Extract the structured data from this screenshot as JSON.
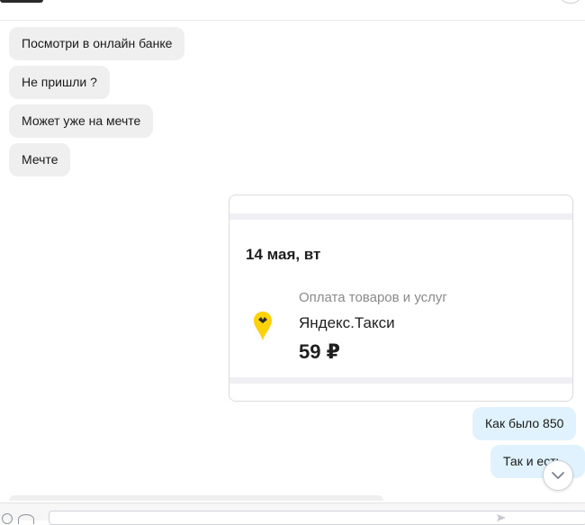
{
  "messages_in": [
    {
      "text": "Посмотри в онлайн банке"
    },
    {
      "text": "Не пришли ?"
    },
    {
      "text": "Может уже на мечте"
    },
    {
      "text": "Мечте"
    }
  ],
  "attachment": {
    "date": "14 мая, вт",
    "category": "Оплата товаров и услуг",
    "merchant": "Яндекс.Такси",
    "amount": "59 ₽",
    "icon": "yandex-taxi-pin-icon",
    "icon_color": "#fcd20a"
  },
  "messages_out": [
    {
      "text": "Как было 850"
    },
    {
      "text": "Так и есть"
    }
  ],
  "colors": {
    "incoming_bubble": "#efefef",
    "outgoing_bubble": "#dff2fd"
  },
  "icons": {
    "scroll_down": "chevron-down-icon",
    "composer_left": "smiley-icon",
    "composer_left2": "attach-icon",
    "composer_send": "send-icon"
  }
}
